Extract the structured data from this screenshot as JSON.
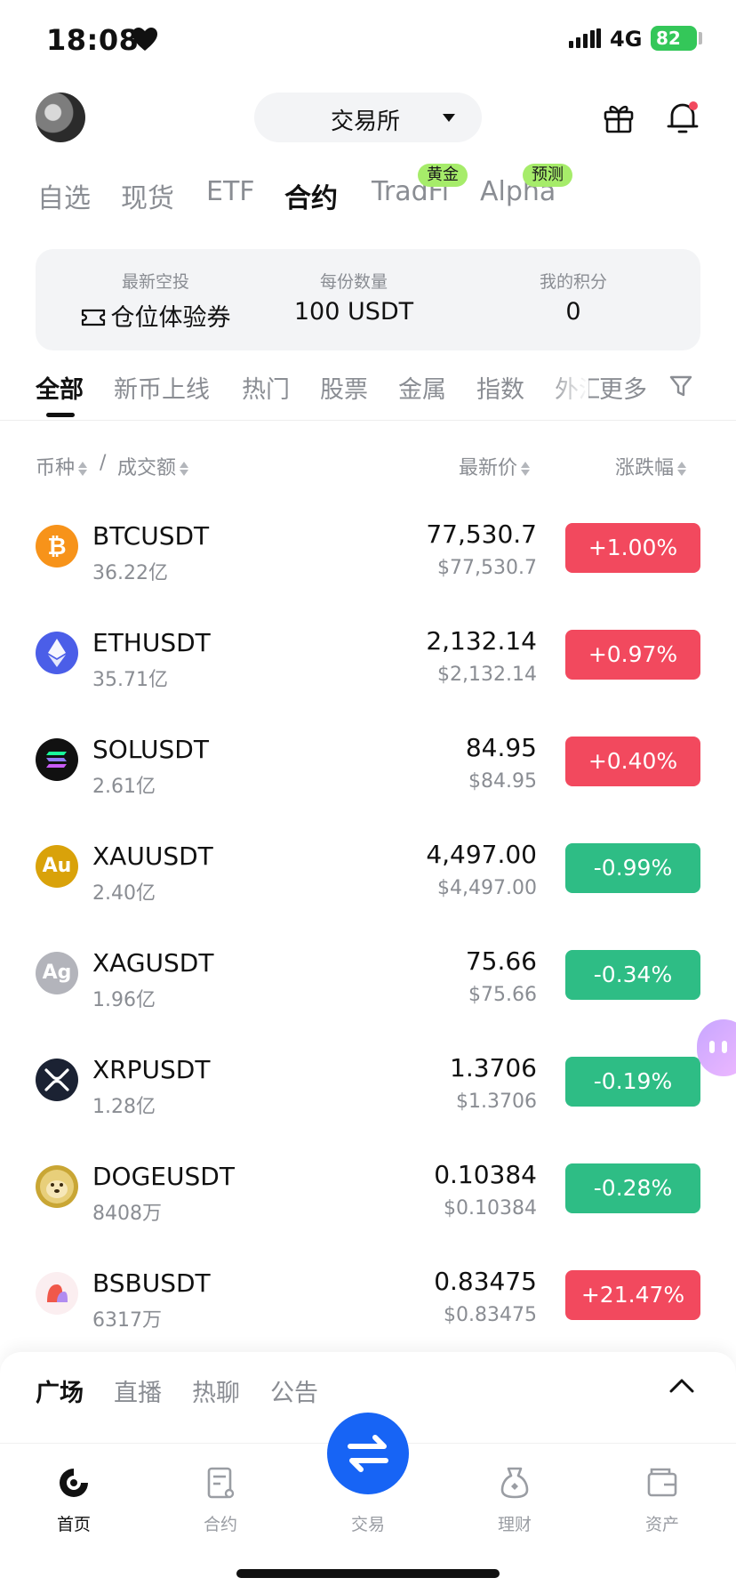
{
  "status_bar": {
    "time": "18:08",
    "network": "4G",
    "battery": "82"
  },
  "header": {
    "exchange_label": "交易所"
  },
  "top_tabs": [
    {
      "label": "自选",
      "active": false
    },
    {
      "label": "现货",
      "active": false
    },
    {
      "label": "ETF",
      "active": false
    },
    {
      "label": "合约",
      "active": true
    },
    {
      "label": "TradFi",
      "active": false,
      "tag": "黄金"
    },
    {
      "label": "Alpha",
      "active": false,
      "tag": "预测"
    }
  ],
  "promo": [
    {
      "label": "最新空投",
      "value": "仓位体验券"
    },
    {
      "label": "每份数量",
      "value": "100 USDT"
    },
    {
      "label": "我的积分",
      "value": "0"
    }
  ],
  "category_tabs": [
    "全部",
    "新币上线",
    "热门",
    "股票",
    "金属",
    "指数",
    "外汇",
    "更多"
  ],
  "table_header": {
    "coin": "币种",
    "slash": "/",
    "volume": "成交额",
    "price": "最新价",
    "change": "涨跌幅"
  },
  "colors": {
    "up": "#f2495e",
    "down": "#2ebd85",
    "accent": "#1764f5"
  },
  "rows": [
    {
      "symbol": "BTCUSDT",
      "volume": "36.22亿",
      "price": "77,530.7",
      "usd": "$77,530.7",
      "change": "+1.00%",
      "direction": "up",
      "icon": "bitcoin-icon"
    },
    {
      "symbol": "ETHUSDT",
      "volume": "35.71亿",
      "price": "2,132.14",
      "usd": "$2,132.14",
      "change": "+0.97%",
      "direction": "up",
      "icon": "ethereum-icon"
    },
    {
      "symbol": "SOLUSDT",
      "volume": "2.61亿",
      "price": "84.95",
      "usd": "$84.95",
      "change": "+0.40%",
      "direction": "up",
      "icon": "solana-icon"
    },
    {
      "symbol": "XAUUSDT",
      "volume": "2.40亿",
      "price": "4,497.00",
      "usd": "$4,497.00",
      "change": "-0.99%",
      "direction": "down",
      "icon": "gold-icon",
      "icon_text": "Au"
    },
    {
      "symbol": "XAGUSDT",
      "volume": "1.96亿",
      "price": "75.66",
      "usd": "$75.66",
      "change": "-0.34%",
      "direction": "down",
      "icon": "silver-icon",
      "icon_text": "Ag"
    },
    {
      "symbol": "XRPUSDT",
      "volume": "1.28亿",
      "price": "1.3706",
      "usd": "$1.3706",
      "change": "-0.19%",
      "direction": "down",
      "icon": "xrp-icon"
    },
    {
      "symbol": "DOGEUSDT",
      "volume": "8408万",
      "price": "0.10384",
      "usd": "$0.10384",
      "change": "-0.28%",
      "direction": "down",
      "icon": "doge-icon"
    },
    {
      "symbol": "BSBUSDT",
      "volume": "6317万",
      "price": "0.83475",
      "usd": "$0.83475",
      "change": "+21.47%",
      "direction": "up",
      "icon": "bsb-icon"
    }
  ],
  "sheet_tabs": [
    {
      "label": "广场",
      "active": true
    },
    {
      "label": "直播",
      "active": false
    },
    {
      "label": "热聊",
      "active": false
    },
    {
      "label": "公告",
      "active": false
    }
  ],
  "bottom_nav": [
    {
      "label": "首页",
      "active": true
    },
    {
      "label": "合约",
      "active": false
    },
    {
      "label": "交易",
      "active": false
    },
    {
      "label": "理财",
      "active": false
    },
    {
      "label": "资产",
      "active": false
    }
  ]
}
